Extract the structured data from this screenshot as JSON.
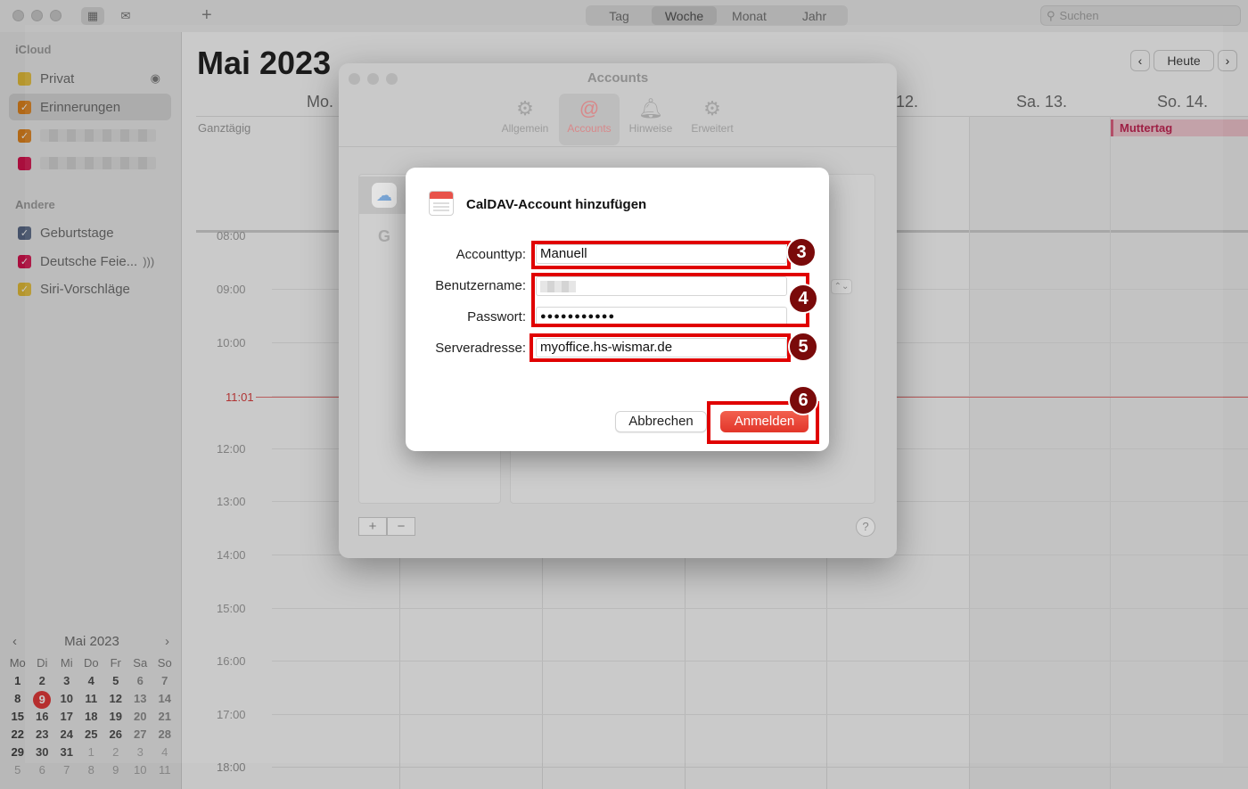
{
  "toolbar": {
    "views": [
      "Tag",
      "Woche",
      "Monat",
      "Jahr"
    ],
    "active_view": "Woche",
    "search_placeholder": "Suchen"
  },
  "sidebar": {
    "section_icloud": "iCloud",
    "section_other": "Andere",
    "icloud_items": [
      {
        "label": "Privat",
        "color": "#e8c13a"
      },
      {
        "label": "Erinnerungen",
        "color": "#e3861e"
      },
      {
        "label": "",
        "color": "#e3861e"
      },
      {
        "label": "",
        "color": "#d9134f"
      }
    ],
    "other_items": [
      {
        "label": "Geburtstage",
        "color": "#5a6a88"
      },
      {
        "label": "Deutsche Feie...",
        "color": "#d9134f"
      },
      {
        "label": "Siri-Vorschläge",
        "color": "#e8c13a"
      }
    ]
  },
  "mini_calendar": {
    "title": "Mai 2023",
    "weekdays": [
      "Mo",
      "Di",
      "Mi",
      "Do",
      "Fr",
      "Sa",
      "So"
    ],
    "rows": [
      [
        "1",
        "2",
        "3",
        "4",
        "5",
        "6",
        "7"
      ],
      [
        "8",
        "9",
        "10",
        "11",
        "12",
        "13",
        "14"
      ],
      [
        "15",
        "16",
        "17",
        "18",
        "19",
        "20",
        "21"
      ],
      [
        "22",
        "23",
        "24",
        "25",
        "26",
        "27",
        "28"
      ],
      [
        "29",
        "30",
        "31",
        "1",
        "2",
        "3",
        "4"
      ],
      [
        "5",
        "6",
        "7",
        "8",
        "9",
        "10",
        "11"
      ]
    ],
    "today": "9"
  },
  "main": {
    "month_title": "Mai 2023",
    "today_button": "Heute",
    "day_headers": [
      "Mo.",
      "12.",
      "Sa. 13.",
      "So. 14."
    ],
    "allday_label": "Ganztägig",
    "event_label": "Muttertag",
    "current_time": "11:01",
    "hours": [
      "08:00",
      "09:00",
      "10:00",
      "12:00",
      "13:00",
      "14:00",
      "15:00",
      "16:00",
      "17:00",
      "18:00"
    ]
  },
  "prefs": {
    "title": "Accounts",
    "tabs": [
      "Allgemein",
      "Accounts",
      "Hinweise",
      "Erweitert"
    ],
    "active_tab": "Accounts",
    "add_button": "+",
    "remove_button": "−",
    "help_button": "?"
  },
  "sheet": {
    "title": "CalDAV-Account hinzufügen",
    "account_type_label": "Accounttyp:",
    "account_type_value": "Manuell",
    "username_label": "Benutzername:",
    "password_label": "Passwort:",
    "password_value": "●●●●●●●●●●●",
    "server_label": "Serveradresse:",
    "server_value": "myoffice.hs-wismar.de",
    "cancel_label": "Abbrechen",
    "signin_label": "Anmelden"
  },
  "annotations": {
    "markers": [
      "3",
      "4",
      "5",
      "6"
    ],
    "color": "#e00000"
  }
}
